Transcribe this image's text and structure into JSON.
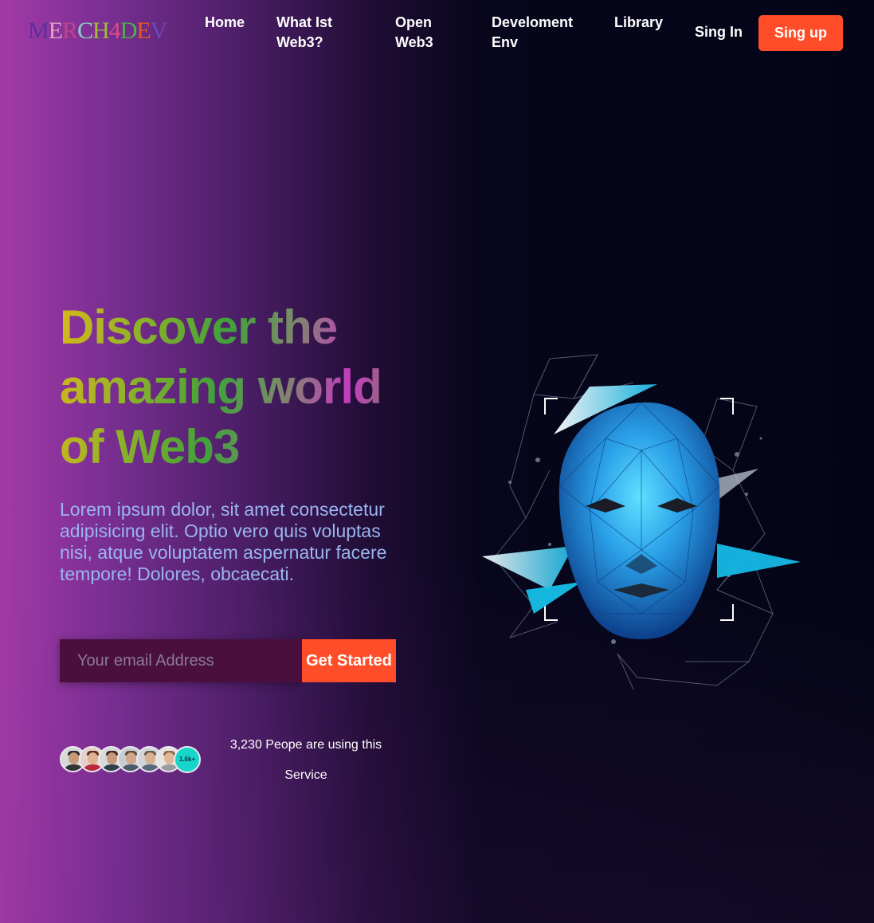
{
  "header": {
    "logo_letters": [
      {
        "ch": "M",
        "color": "#5a2fa0"
      },
      {
        "ch": "E",
        "color": "#e0a4c8"
      },
      {
        "ch": "R",
        "color": "#c0448c"
      },
      {
        "ch": "C",
        "color": "#8ad0c8"
      },
      {
        "ch": "H",
        "color": "#9fbf3a"
      },
      {
        "ch": "4",
        "color": "#e04a88"
      },
      {
        "ch": "D",
        "color": "#4fb04a"
      },
      {
        "ch": "E",
        "color": "#e05a2a"
      },
      {
        "ch": "V",
        "color": "#6a4ab8"
      }
    ],
    "nav": {
      "home": "Home",
      "what_is_web3": "What Ist Web3?",
      "open_web3": "Open Web3",
      "development_env": "Develoment Env",
      "library": "Library"
    },
    "sign_in": "Sing In",
    "sign_up": "Sing up"
  },
  "hero": {
    "title": "Discover the amazing world of Web3",
    "description": "Lorem ipsum dolor, sit amet consectetur adipisicing elit. Optio vero quis voluptas nisi, atque voluptatem aspernatur facere tempore! Dolores, obcaecati.",
    "email_placeholder": "Your email Address",
    "cta_label": "Get Started"
  },
  "social_proof": {
    "avatar_count_badge": "1.6k+",
    "users_text": "3,230 Peope are using this Service"
  },
  "colors": {
    "accent": "#ff4d29",
    "description": "#9ab5f0",
    "input_bg": "#4a0f3f"
  }
}
